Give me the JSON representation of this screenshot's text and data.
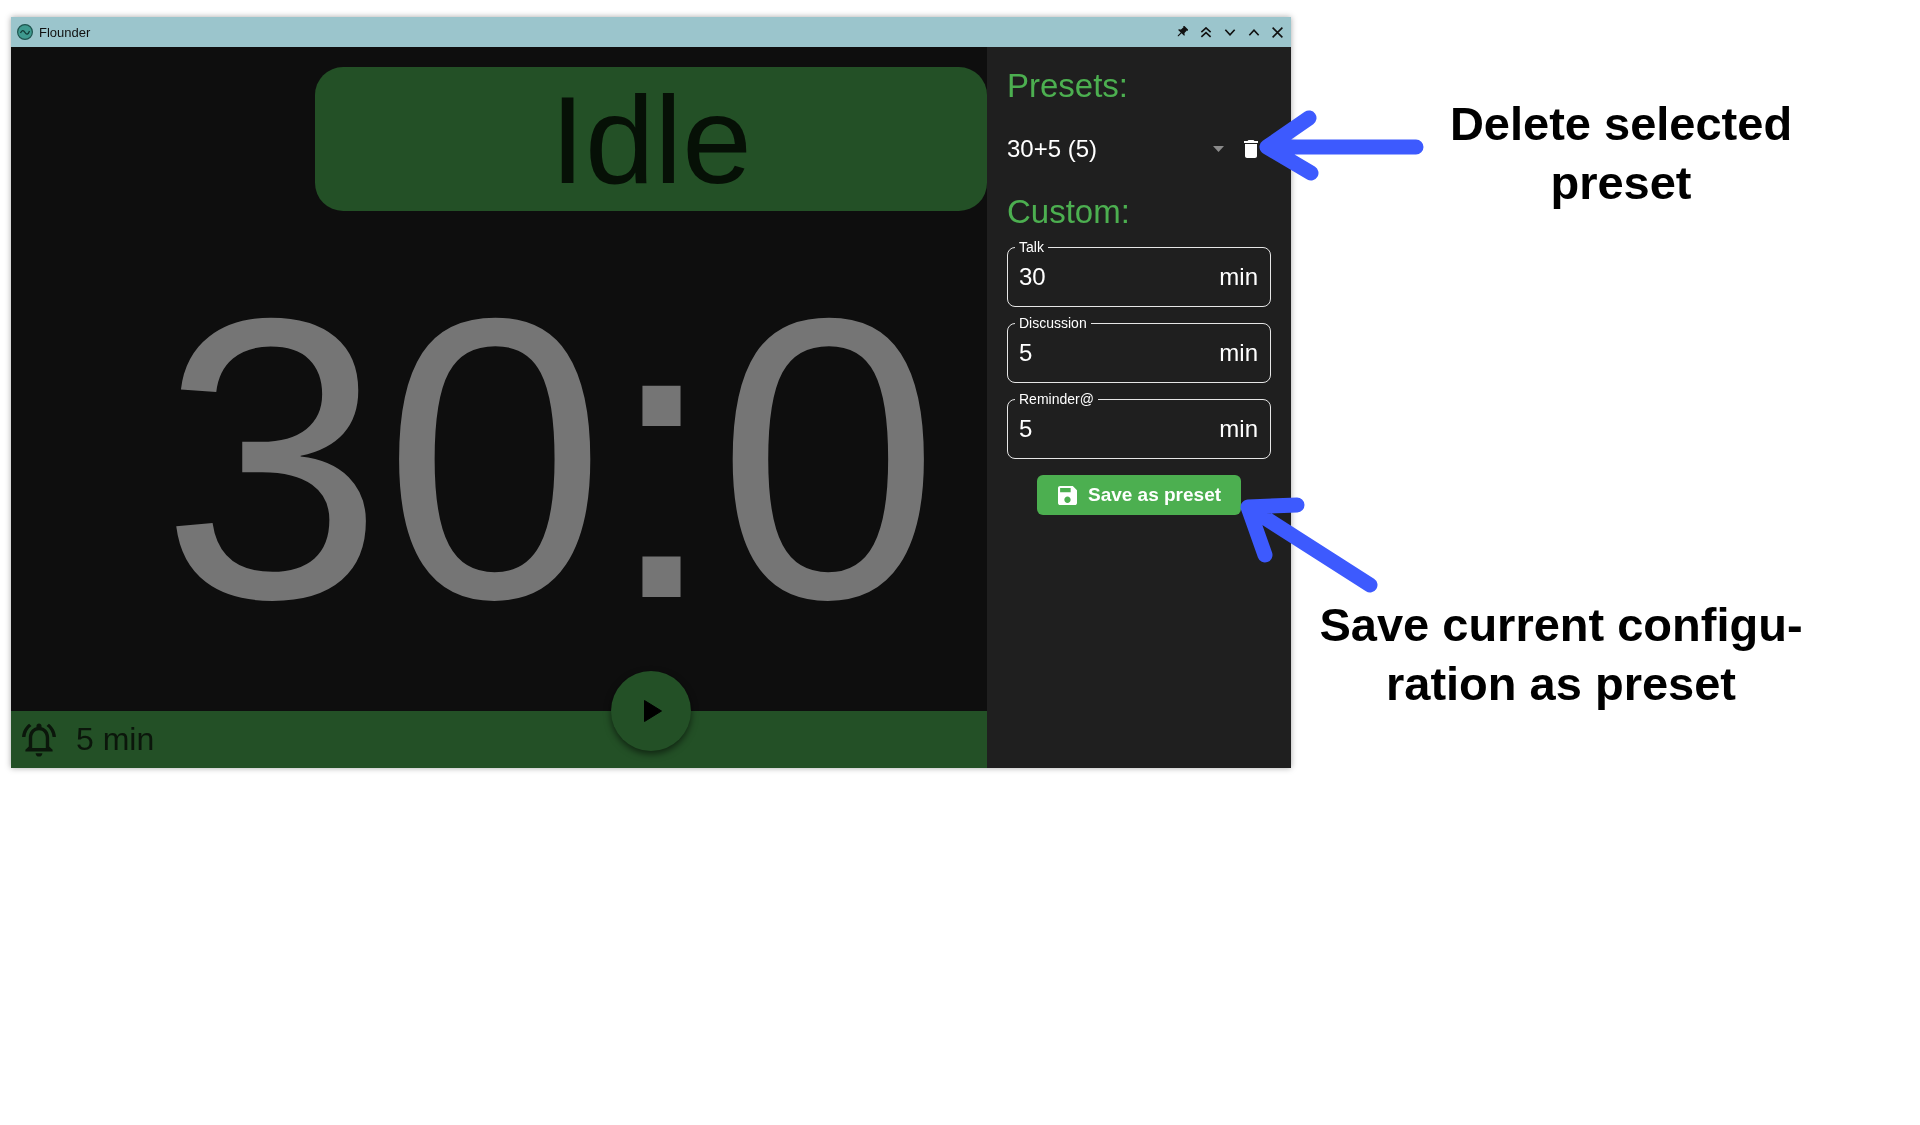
{
  "window": {
    "title": "Flounder"
  },
  "status": {
    "label": "Idle"
  },
  "timer": {
    "display": "30:0"
  },
  "bottom_bar": {
    "reminder": "5 min"
  },
  "sidebar": {
    "presets_heading": "Presets:",
    "preset_select": {
      "value": "30+5 (5)"
    },
    "custom_heading": "Custom:",
    "fields": [
      {
        "label": "Talk",
        "value": "30",
        "unit": "min"
      },
      {
        "label": "Discussion",
        "value": "5",
        "unit": "min"
      },
      {
        "label": "Reminder@",
        "value": "5",
        "unit": "min"
      }
    ],
    "save_button": {
      "label": "Save as preset"
    }
  },
  "annotations": [
    {
      "lines": [
        "Delete selected",
        "preset"
      ]
    },
    {
      "lines": [
        "Save current configu-",
        "ration as preset"
      ]
    }
  ]
}
